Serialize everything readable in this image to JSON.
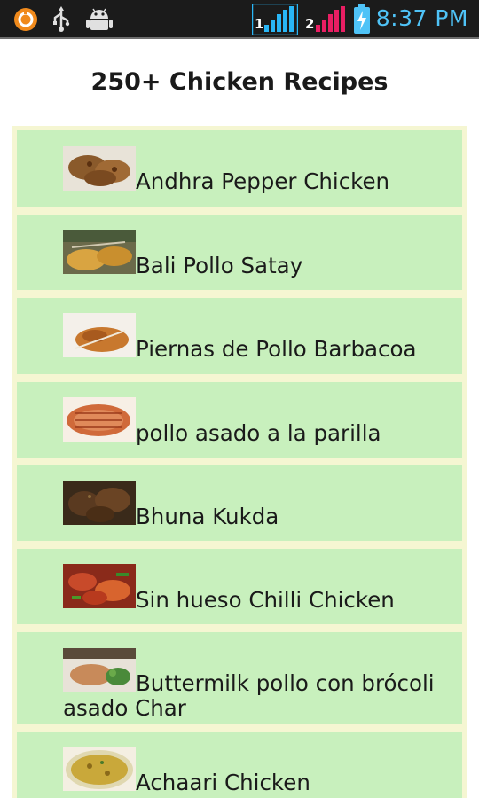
{
  "status_bar": {
    "time": "8:37 PM",
    "sim1_label": "1",
    "sim2_label": "2",
    "icons": [
      "notification-app-icon",
      "usb-icon",
      "android-debug-icon",
      "signal-sim1-icon",
      "signal-sim2-icon",
      "battery-charging-icon"
    ]
  },
  "header": {
    "title": "250+ Chicken Recipes"
  },
  "recipes": [
    {
      "name": "Andhra Pepper Chicken",
      "thumb": "andhra-pepper-chicken-thumbnail"
    },
    {
      "name": "Bali Pollo Satay",
      "thumb": "bali-pollo-satay-thumbnail"
    },
    {
      "name": "Piernas de Pollo Barbacoa",
      "thumb": "piernas-de-pollo-barbacoa-thumbnail"
    },
    {
      "name": "pollo asado a la parilla",
      "thumb": "pollo-asado-thumbnail"
    },
    {
      "name": "Bhuna Kukda",
      "thumb": "bhuna-kukda-thumbnail"
    },
    {
      "name": "Sin hueso Chilli Chicken",
      "thumb": "chilli-chicken-thumbnail"
    },
    {
      "name": "Buttermilk pollo con brócoli asado Char",
      "thumb": "buttermilk-pollo-thumbnail"
    },
    {
      "name": "Achaari Chicken",
      "thumb": "achaari-chicken-thumbnail"
    }
  ],
  "colors": {
    "status_bar_bg": "#1b1b1b",
    "time_color": "#4fc3f7",
    "list_bg": "#f5f6d2",
    "row_bg": "#c8f0bd",
    "sim2_signal": "#e91e63"
  }
}
